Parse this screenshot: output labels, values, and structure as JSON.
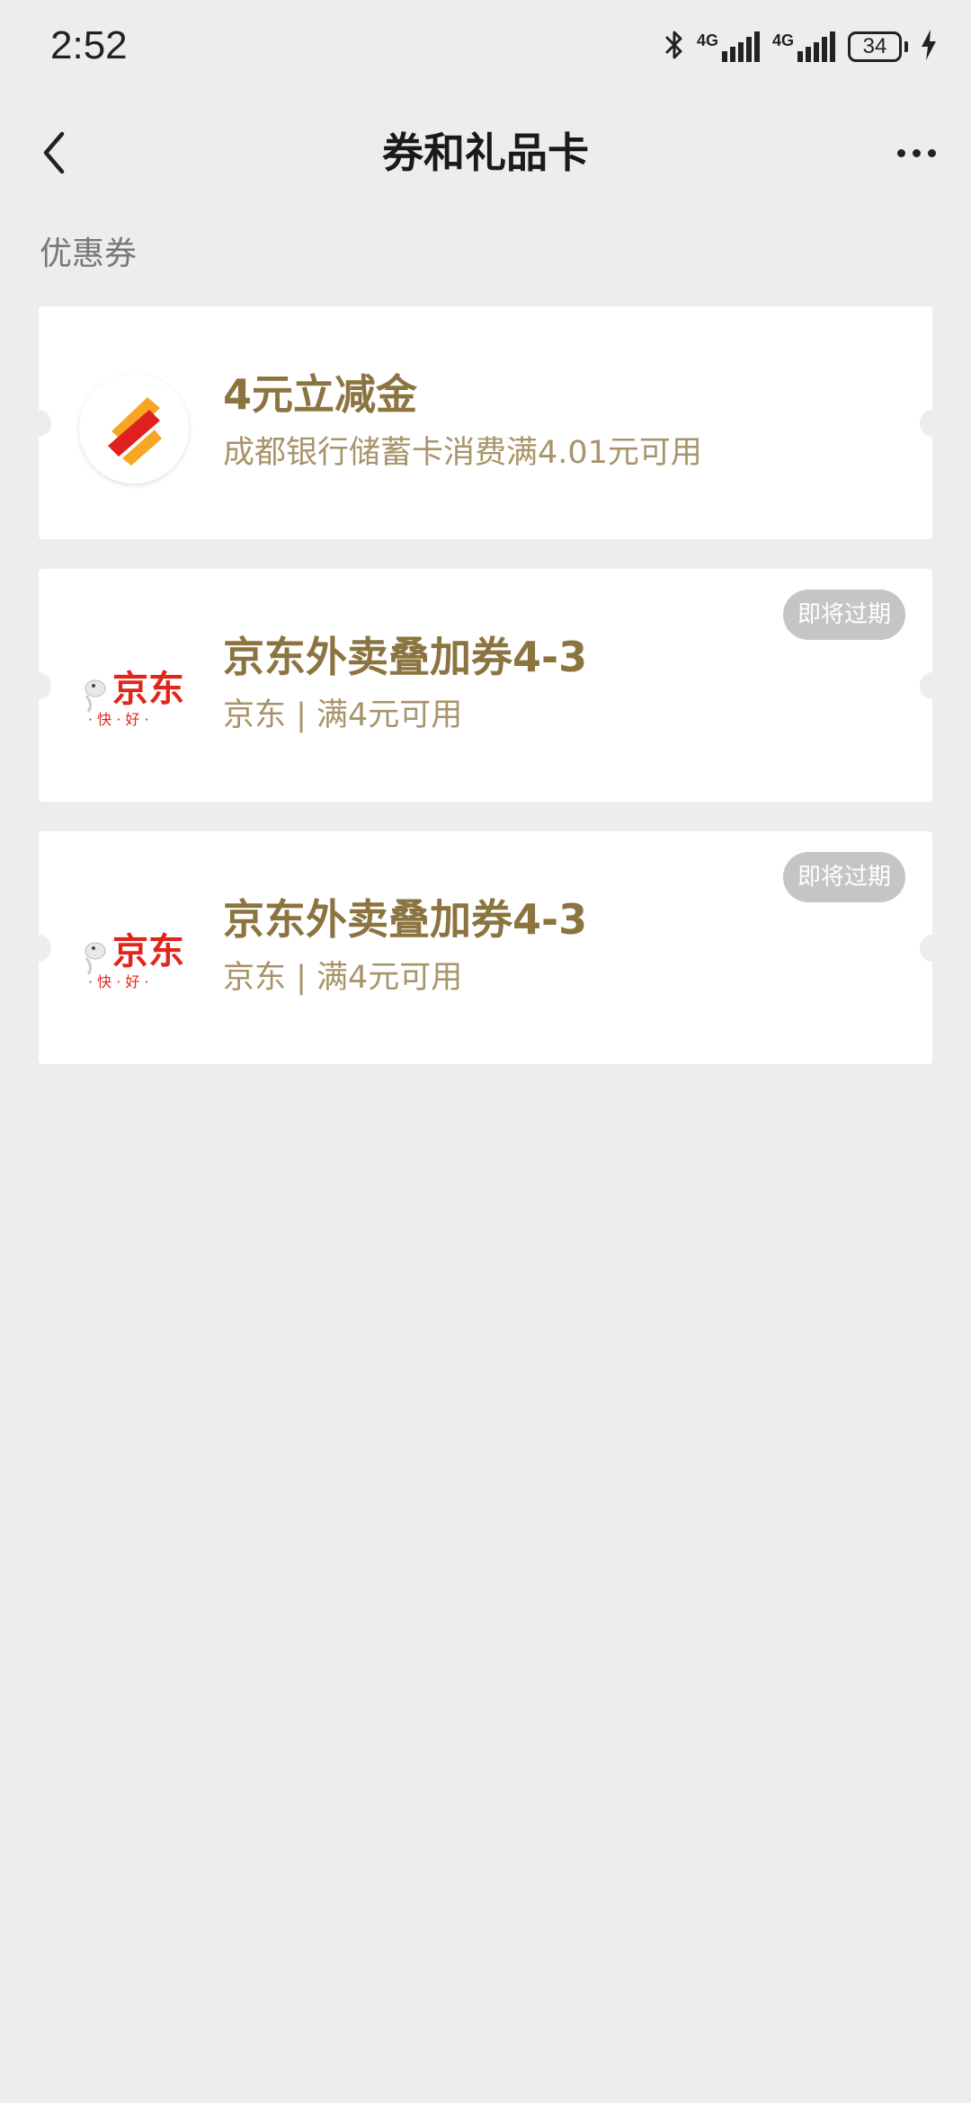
{
  "status_bar": {
    "time": "2:52",
    "network1": "4G",
    "network2": "4G",
    "battery": "34"
  },
  "nav": {
    "title": "券和礼品卡"
  },
  "section": {
    "label": "优惠券"
  },
  "coupons": [
    {
      "title": "4元立减金",
      "desc": "成都银行储蓄卡消费满4.01元可用",
      "logo": "chengdu-bank-logo",
      "badge": ""
    },
    {
      "title": "京东外卖叠加券4-3",
      "desc": "京东 | 满4元可用",
      "logo": "jd-logo",
      "badge": "即将过期"
    },
    {
      "title": "京东外卖叠加券4-3",
      "desc": "京东 | 满4元可用",
      "logo": "jd-logo",
      "badge": "即将过期"
    }
  ],
  "jd_logo": {
    "brand_text": "京东",
    "slogan": "· 快 · 好 ·"
  },
  "colors": {
    "background": "#ededed",
    "coupon_title": "#8b7440",
    "coupon_desc": "#a8946a",
    "badge_bg": "#c5c5c5",
    "jd_red": "#e1251b",
    "bank_orange": "#f5a623",
    "bank_red": "#e02020"
  }
}
